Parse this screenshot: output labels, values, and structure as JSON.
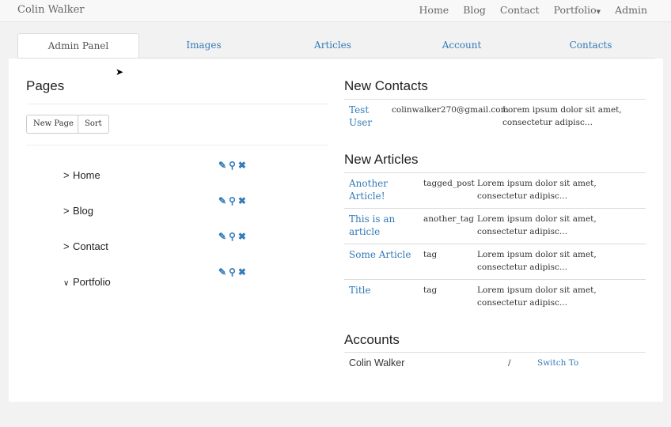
{
  "navbar": {
    "brand": "Colin Walker",
    "links": [
      "Home",
      "Blog",
      "Contact",
      "Portfolio",
      "Admin"
    ]
  },
  "tabs": [
    "Admin Panel",
    "Images",
    "Articles",
    "Account",
    "Contacts"
  ],
  "pages": {
    "title": "Pages",
    "new_page": "New Page",
    "sort": "Sort",
    "items": [
      {
        "label": "Home",
        "expanded": false
      },
      {
        "label": "Blog",
        "expanded": false
      },
      {
        "label": "Contact",
        "expanded": false
      },
      {
        "label": "Portfolio",
        "expanded": true
      }
    ]
  },
  "contacts": {
    "title": "New Contacts",
    "rows": [
      {
        "name": "Test User",
        "email": "colinwalker270@gmail.com",
        "message": "Lorem ipsum dolor sit amet, consectetur adipisc..."
      }
    ]
  },
  "articles": {
    "title": "New Articles",
    "rows": [
      {
        "title": "Another Article!",
        "tag": "tagged_post",
        "body": "Lorem ipsum dolor sit amet, consectetur adipisc..."
      },
      {
        "title": "This is an article",
        "tag": "another_tag",
        "body": "Lorem ipsum dolor sit amet, consectetur adipisc..."
      },
      {
        "title": "Some Article",
        "tag": "tag",
        "body": "Lorem ipsum dolor sit amet, consectetur adipisc..."
      },
      {
        "title": "Title",
        "tag": "tag",
        "body": "Lorem ipsum dolor sit amet, consectetur adipisc..."
      }
    ]
  },
  "accounts": {
    "title": "Accounts",
    "rows": [
      {
        "name": "Colin Walker",
        "sep": "/",
        "action": "Switch To"
      }
    ]
  }
}
